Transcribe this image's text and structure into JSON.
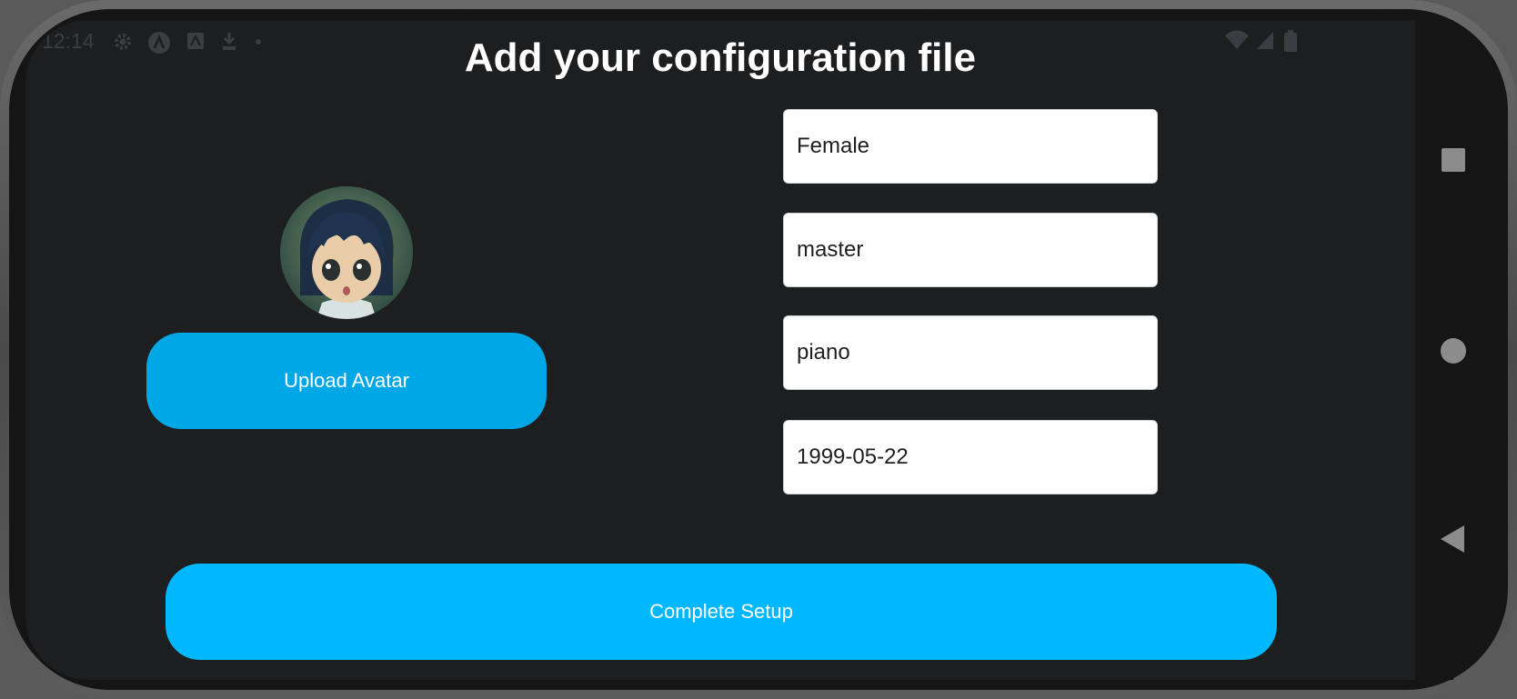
{
  "status_bar": {
    "time": "12:14",
    "icons_left": [
      "settings-icon",
      "app-icon",
      "notification-icon",
      "download-icon",
      "dot-icon"
    ],
    "icons_right": [
      "wifi-icon",
      "signal-icon",
      "battery-icon"
    ]
  },
  "page": {
    "title": "Add your configuration file"
  },
  "profile": {
    "avatar_alt": "avatar",
    "upload_label": "Upload Avatar"
  },
  "form": {
    "gender": "Female",
    "role": "master",
    "instrument": "piano",
    "birthdate": "1999-05-22"
  },
  "actions": {
    "complete_label": "Complete Setup"
  },
  "navigation": {
    "buttons": [
      "recents-icon",
      "home-icon",
      "back-icon"
    ]
  },
  "colors": {
    "background": "#1d1e20",
    "upload_button": "#00a7e6",
    "complete_button": "#00b8ff",
    "title": "#ffffff"
  }
}
